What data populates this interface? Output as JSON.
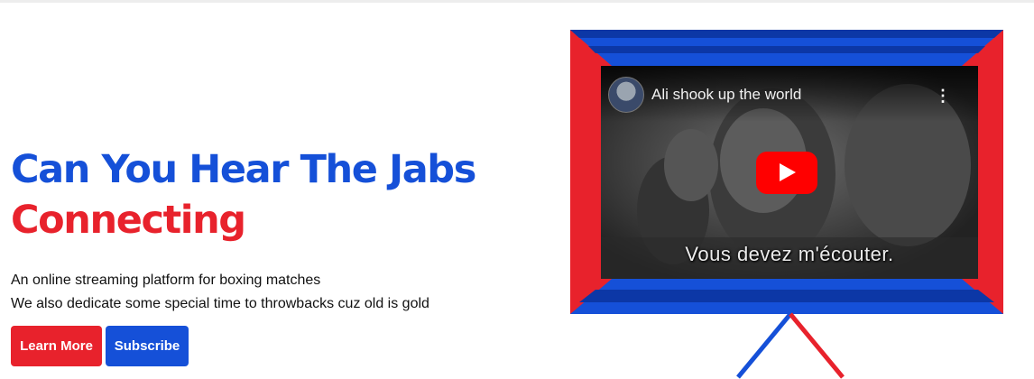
{
  "hero": {
    "title_line1": "Can You Hear The Jabs",
    "title_line2": "Connecting",
    "desc_line1": "An online streaming platform for boxing matches",
    "desc_line2": "We also dedicate some special time to throwbacks cuz old is gold",
    "learn_more": "Learn More",
    "subscribe": "Subscribe"
  },
  "video": {
    "title": "Ali shook up the world",
    "subtitle": "Vous devez m'écouter.",
    "menu_glyph": "⋮",
    "icons": [
      "channel-avatar",
      "kebab-menu-icon",
      "youtube-play-icon"
    ]
  },
  "colors": {
    "blue": "#1550d8",
    "red": "#e8222c",
    "dark_blue": "#0c37a6"
  }
}
